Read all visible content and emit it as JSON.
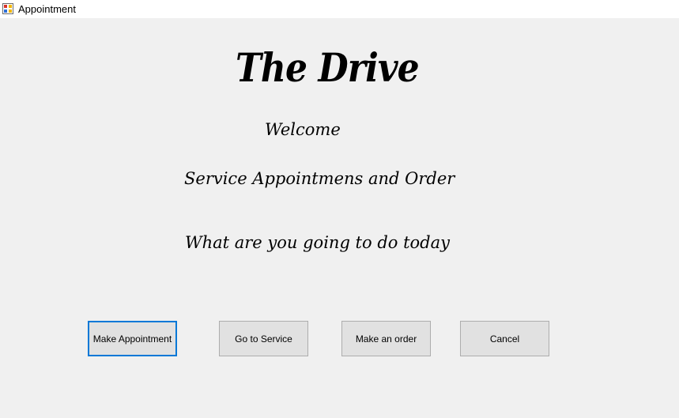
{
  "window": {
    "title": "Appointment",
    "icon": "winforms-app-icon"
  },
  "form": {
    "brand": "The Drive",
    "welcome": "Welcome",
    "subtitle": "Service Appointmens  and Order",
    "question": "What are you going to do today"
  },
  "buttons": {
    "make_appointment": "Make Appointment",
    "go_to_service": "Go to Service",
    "make_order": "Make an order",
    "cancel": "Cancel"
  },
  "colors": {
    "focus_accent": "#0078d7",
    "button_face": "#e1e1e1",
    "form_background": "#f0f0f0"
  }
}
